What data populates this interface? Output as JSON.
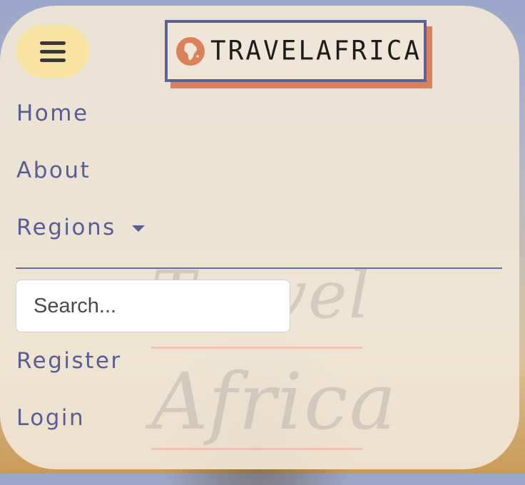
{
  "brand": {
    "name": "TRAVELAFRICA",
    "logo_icon": "africa-globe-icon",
    "accent": "#d98259",
    "border": "#5e6196"
  },
  "menu_toggle": {
    "icon": "hamburger-icon",
    "color": "#f7e4a3"
  },
  "nav": {
    "home": "Home",
    "about": "About",
    "regions": "Regions",
    "register": "Register",
    "login": "Login",
    "link_color": "#5a5c96"
  },
  "search": {
    "placeholder": "Search...",
    "value": ""
  },
  "watermark": {
    "line1": "Travel",
    "line2": "Africa"
  }
}
